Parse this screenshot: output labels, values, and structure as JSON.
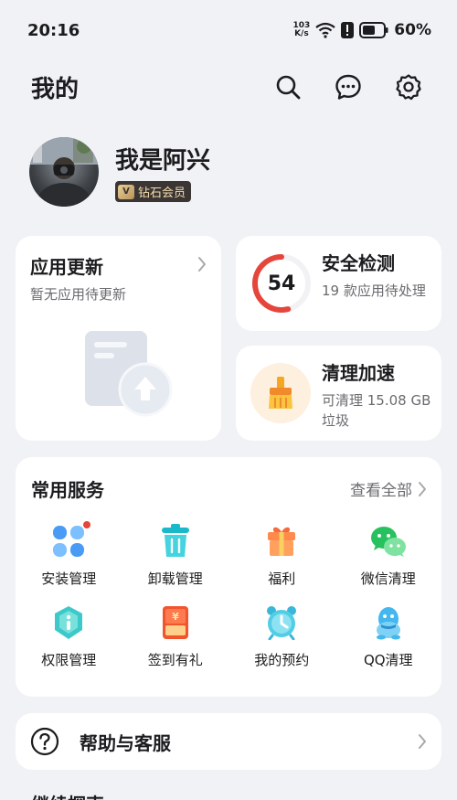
{
  "status_bar": {
    "time": "20:16",
    "net_speed_value": "103",
    "net_speed_unit": "K/s",
    "battery": "60%"
  },
  "header": {
    "title": "我的"
  },
  "profile": {
    "name": "我是阿兴",
    "badge": "钻石会员",
    "badge_logo": "V"
  },
  "update_card": {
    "title": "应用更新",
    "subtitle": "暂无应用待更新"
  },
  "security_card": {
    "score": "54",
    "title": "安全检测",
    "subtitle": "19 款应用待处理",
    "score_fraction": 0.54
  },
  "clean_card": {
    "title": "清理加速",
    "subtitle": "可清理 15.08 GB 垃圾"
  },
  "services": {
    "title": "常用服务",
    "view_all": "查看全部",
    "items": [
      {
        "label": "安装管理",
        "icon": "install-manage-icon"
      },
      {
        "label": "卸载管理",
        "icon": "uninstall-manage-icon"
      },
      {
        "label": "福利",
        "icon": "gift-icon"
      },
      {
        "label": "微信清理",
        "icon": "wechat-clean-icon"
      },
      {
        "label": "权限管理",
        "icon": "permission-manage-icon"
      },
      {
        "label": "签到有礼",
        "icon": "checkin-gift-icon"
      },
      {
        "label": "我的预约",
        "icon": "alarm-clock-icon"
      },
      {
        "label": "QQ清理",
        "icon": "qq-clean-icon"
      }
    ]
  },
  "help": {
    "label": "帮助与客服"
  },
  "cutoff_text": "继续探索",
  "colors": {
    "background": "#f1f2f6",
    "accent_orange": "#f08a2a",
    "gauge_red": "#e5453a",
    "vip_gold": "#f1dcae"
  }
}
